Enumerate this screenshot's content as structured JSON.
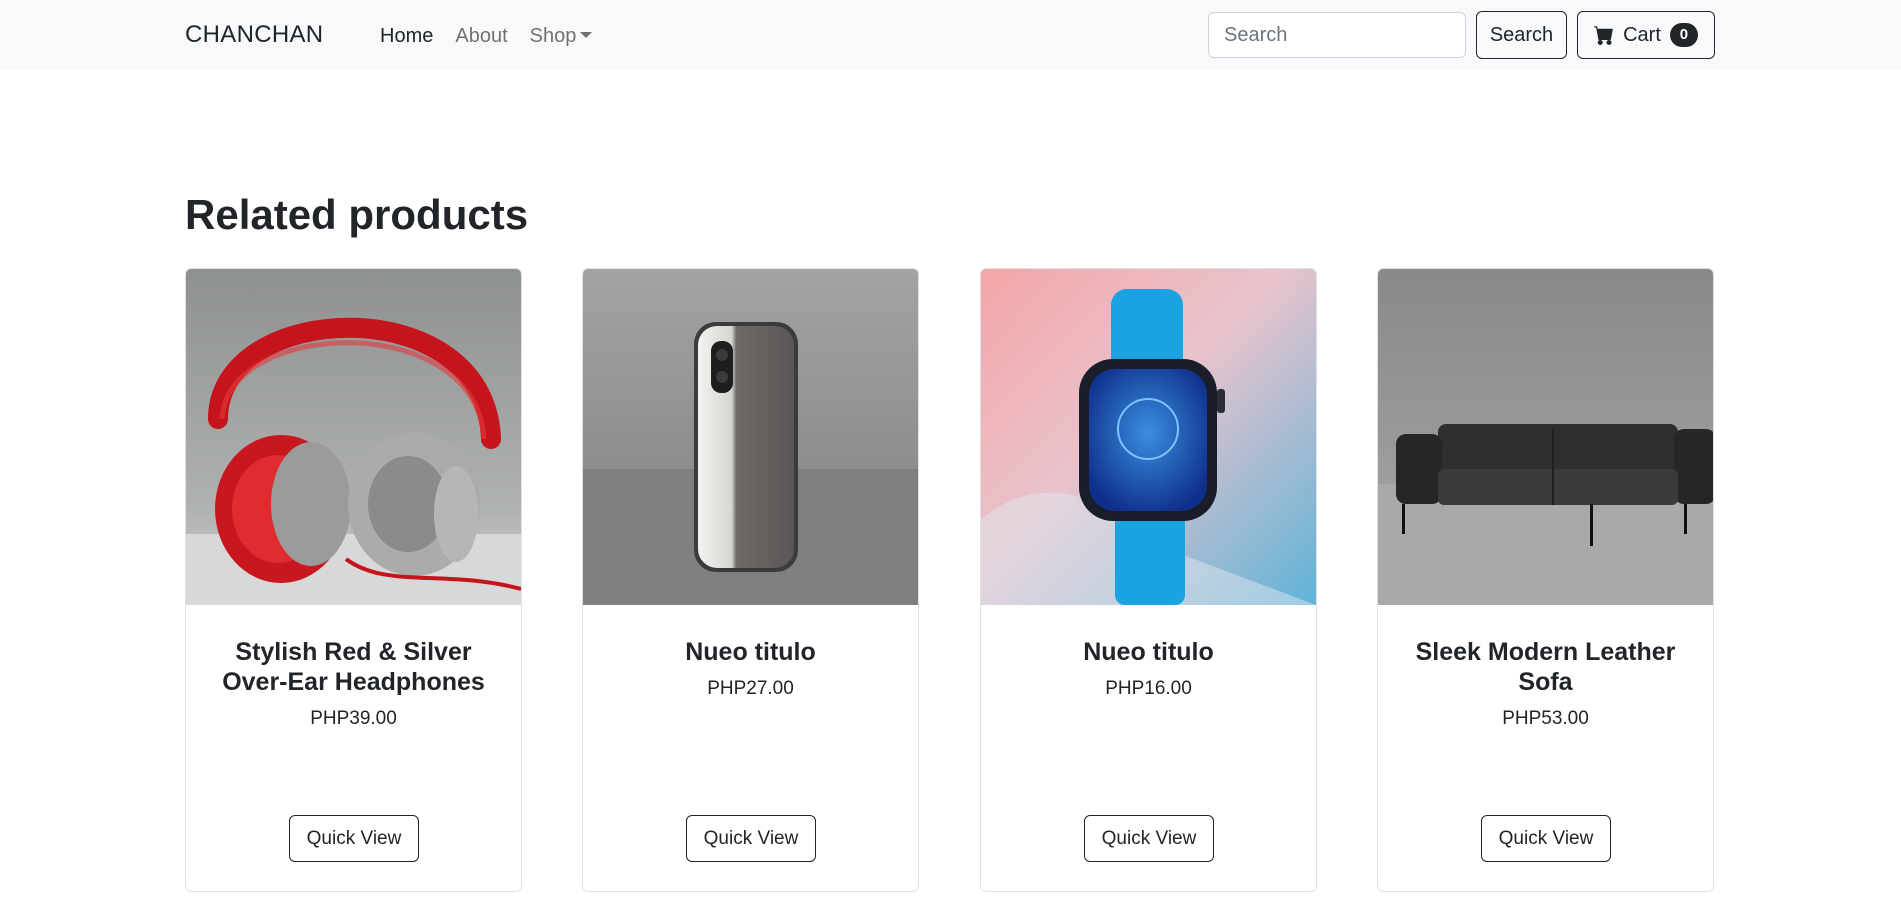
{
  "brand": "CHANCHAN",
  "nav": {
    "home": "Home",
    "about": "About",
    "shop": "Shop"
  },
  "search": {
    "placeholder": "Search",
    "value": "",
    "button_label": "Search"
  },
  "cart": {
    "label": "Cart",
    "count": "0",
    "icon": "cart-icon"
  },
  "section_title": "Related products",
  "products": [
    {
      "title": "Stylish Red & Silver Over-Ear Headphones",
      "price": "PHP39.00",
      "button_label": "Quick View",
      "image": "headphones"
    },
    {
      "title": "Nueo titulo",
      "price": "PHP27.00",
      "button_label": "Quick View",
      "image": "phone"
    },
    {
      "title": "Nueo titulo",
      "price": "PHP16.00",
      "button_label": "Quick View",
      "image": "smartwatch"
    },
    {
      "title": "Sleek Modern Leather Sofa",
      "price": "PHP53.00",
      "button_label": "Quick View",
      "image": "sofa"
    }
  ],
  "colors": {
    "navbar_bg": "#f8f9fa",
    "text": "#212529",
    "muted": "#6c757d",
    "border": "#dee2e6"
  }
}
